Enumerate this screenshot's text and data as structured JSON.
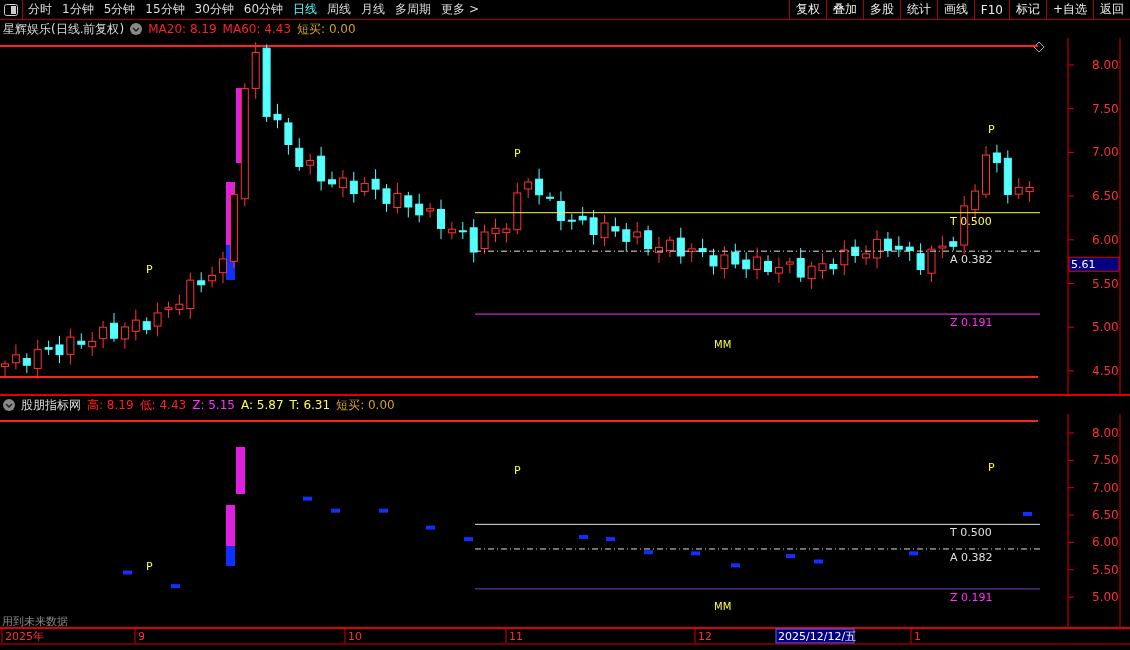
{
  "toolbar": {
    "periods": [
      {
        "label": "分时",
        "selected": false
      },
      {
        "label": "1分钟",
        "selected": false
      },
      {
        "label": "5分钟",
        "selected": false
      },
      {
        "label": "15分钟",
        "selected": false
      },
      {
        "label": "30分钟",
        "selected": false
      },
      {
        "label": "60分钟",
        "selected": false
      },
      {
        "label": "日线",
        "selected": true
      },
      {
        "label": "周线",
        "selected": false
      },
      {
        "label": "月线",
        "selected": false
      },
      {
        "label": "多周期",
        "selected": false
      },
      {
        "label": "更多 >",
        "selected": false
      }
    ],
    "buttons": [
      "复权",
      "叠加",
      "多股",
      "统计",
      "画线",
      "F10",
      "标记",
      "+自选",
      "返回"
    ]
  },
  "main_panel": {
    "title": "星辉娱乐(日线.前复权)",
    "indicators": [
      {
        "label": "MA20: 8.19",
        "color": "#ff2020"
      },
      {
        "label": "MA60: 4.43",
        "color": "#ff2020"
      },
      {
        "label": "短买: 0.00",
        "color": "#d4a020"
      }
    ],
    "y_ticks": [
      "8.00",
      "7.50",
      "7.00",
      "6.50",
      "6.00",
      "5.50",
      "5.00",
      "4.50"
    ],
    "price_tag": "5.61",
    "levels": [
      {
        "label": "T 0.500",
        "color": "#ffff40"
      },
      {
        "label": "A 0.382",
        "color": "#e0e0e0"
      },
      {
        "label": "Z 0.191",
        "color": "#ff30ff"
      }
    ],
    "marks": [
      "P",
      "P",
      "P"
    ],
    "pattern_label": "MM"
  },
  "lower_panel": {
    "title": "股朋指标网",
    "indicators": [
      {
        "label": "高: 8.19",
        "color": "#ff2020"
      },
      {
        "label": "低: 4.43",
        "color": "#ff2020"
      },
      {
        "label": "Z: 5.15",
        "color": "#ff30ff"
      },
      {
        "label": "A: 5.87",
        "color": "#ffff40"
      },
      {
        "label": "T: 6.31",
        "color": "#ffff40"
      },
      {
        "label": "短买: 0.00",
        "color": "#d4a020"
      }
    ],
    "y_ticks": [
      "8.00",
      "7.50",
      "7.00",
      "6.50",
      "6.00",
      "5.50",
      "5.00"
    ],
    "levels": [
      {
        "label": "T 0.500",
        "color": "#e0e0e0"
      },
      {
        "label": "A 0.382",
        "color": "#e0e0e0"
      },
      {
        "label": "Z 0.191",
        "color": "#ff30ff"
      }
    ],
    "marks": [
      "P",
      "P",
      "P"
    ],
    "pattern_label": "MM",
    "note": "用到未来数据"
  },
  "time_axis": {
    "labels": [
      "2025年",
      "9",
      "10",
      "11",
      "12",
      "1"
    ],
    "cursor_date": "2025/12/12/五"
  }
}
